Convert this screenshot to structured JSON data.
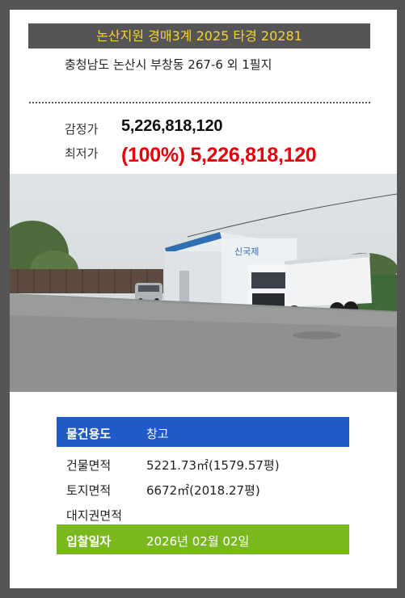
{
  "header": {
    "title": "논산지원 경매3계 2025 타경 20281"
  },
  "address": "충청남도 논산시 부창동 267-6 외 1필지",
  "prices": {
    "appraisal_label": "감정가",
    "appraisal_value": "5,226,818,120",
    "minimum_label": "최저가",
    "minimum_value": "(100%) 5,226,818,120"
  },
  "photo": {
    "sign_text": "신국제"
  },
  "details": [
    {
      "label": "물건용도",
      "value": "창고"
    },
    {
      "label": "건물면적",
      "value": "5221.73㎡(1579.57평)"
    },
    {
      "label": "토지면적",
      "value": "6672㎡(2018.27평)"
    },
    {
      "label": "대지권면적",
      "value": ""
    },
    {
      "label": "입찰일자",
      "value": "2026년 02월 02일"
    }
  ],
  "colors": {
    "header_bg": "#555555",
    "header_text": "#f5d230",
    "price_red": "#e8000b",
    "usage_bg": "#1e5bc6",
    "date_bg": "#7ab91e"
  }
}
